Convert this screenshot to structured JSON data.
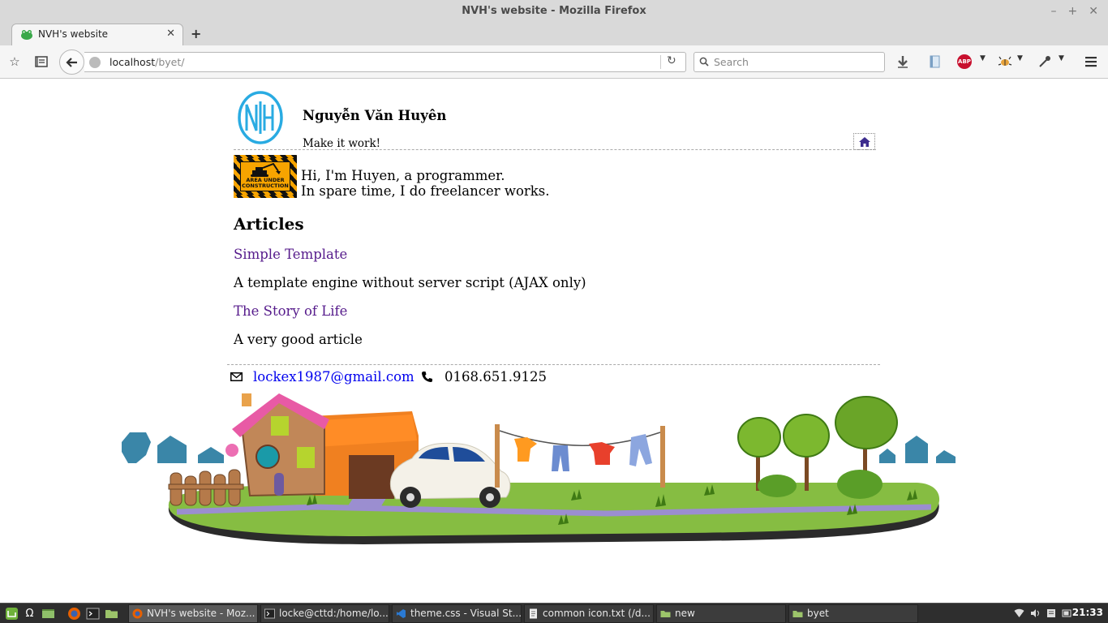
{
  "window": {
    "title": "NVH's website - Mozilla Firefox"
  },
  "tab": {
    "title": "NVH's website"
  },
  "navbar": {
    "url_host": "localhost",
    "url_path": "/byet/",
    "search_placeholder": "Search",
    "adblock_label": "ABP"
  },
  "header": {
    "site_name": "Nguyễn Văn Huyên",
    "tagline": "Make it work!"
  },
  "intro": {
    "badge_line1": "AREA UNDER",
    "badge_line2": "CONSTRUCTION",
    "line1": "Hi, I'm Huyen, a programmer.",
    "line2": "In spare time, I do freelancer works."
  },
  "articles": {
    "heading": "Articles",
    "items": [
      {
        "title": "Simple Template",
        "description": "A template engine without server script (AJAX only)"
      },
      {
        "title": "The Story of Life",
        "description": "A very good article"
      }
    ]
  },
  "footer": {
    "email": "lockex1987@gmail.com",
    "phone": "0168.651.9125"
  },
  "taskbar": {
    "windows": [
      {
        "label": "NVH's website - Moz...",
        "active": true
      },
      {
        "label": "locke@cttd:/home/lo...",
        "active": false
      },
      {
        "label": "theme.css - Visual St...",
        "active": false
      },
      {
        "label": "common icon.txt (/d...",
        "active": false
      },
      {
        "label": "new",
        "active": false
      },
      {
        "label": "byet",
        "active": false
      }
    ],
    "clock": "21:33"
  },
  "colors": {
    "link_visited": "#551a8b",
    "link": "#0000ee",
    "logo": "#29abe2",
    "construction": "#f7a400"
  }
}
